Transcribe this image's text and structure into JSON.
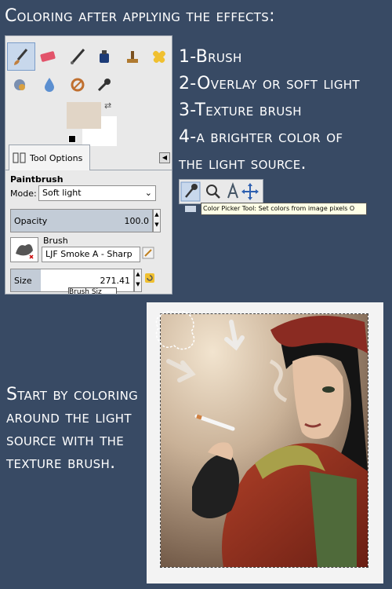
{
  "heading": "Coloring after applying the effects:",
  "steps": [
    "1-Brush",
    "2-Overlay or soft light",
    "3-Texture brush",
    "4-a brighter color of",
    "the light source."
  ],
  "tip_lines": [
    "Start by coloring",
    "around the light",
    "source with the",
    "texture brush."
  ],
  "toolbox": {
    "tools": [
      "paintbrush-icon",
      "eraser-icon",
      "airbrush-icon",
      "ink-icon",
      "clone-stamp-icon",
      "heal-icon",
      "smudge-icon",
      "blur-icon",
      "dodge-burn-icon",
      "color-picker-icon"
    ],
    "fg_color": "#e1d5c6",
    "bg_color": "#ffffff",
    "tab_label": "Tool Options",
    "tool_name": "Paintbrush",
    "mode_label": "Mode:",
    "mode_value": "Soft light",
    "opacity_label": "Opacity",
    "opacity_value": "100.0",
    "brush_label": "Brush",
    "brush_name": "LJF Smoke A - Sharp",
    "size_label": "Size",
    "size_value": "271.41",
    "size_tooltip": "Brush Siz"
  },
  "picker_tooltip": "Color Picker Tool: Set colors from image pixels  O",
  "colors": {
    "background": "#384a64",
    "panel": "#e9e9e9",
    "slider_fill": "#c3ccd7",
    "accent": "#7a9cc8"
  }
}
